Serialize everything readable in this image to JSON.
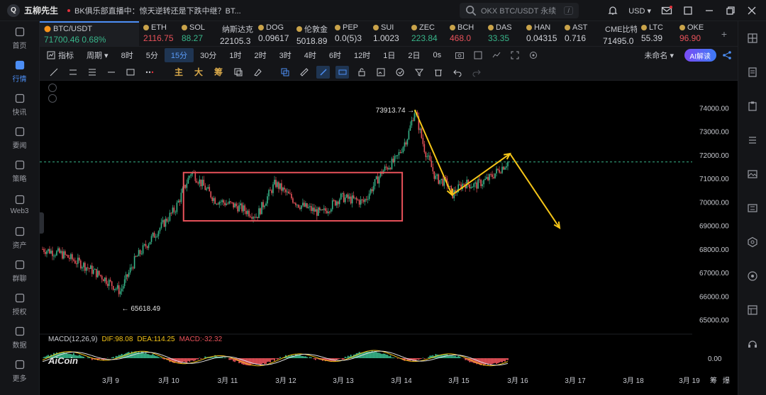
{
  "app": {
    "logo_mark": "Q",
    "name": "五柳先生"
  },
  "news": {
    "text": "BK俱乐部直播中：惊天逆转还是下跌中继？BT..."
  },
  "search": {
    "text": "OKX BTC/USDT 永续",
    "shortcut": "/"
  },
  "topright": {
    "currency": "USD"
  },
  "sidebar": [
    {
      "label": "首页",
      "icon": "home-icon"
    },
    {
      "label": "行情",
      "icon": "market-chart-icon",
      "active": true
    },
    {
      "label": "快讯",
      "icon": "flash-news-icon"
    },
    {
      "label": "要闻",
      "icon": "news-icon"
    },
    {
      "label": "策略",
      "icon": "strategy-icon"
    },
    {
      "label": "Web3",
      "icon": "web3-icon"
    },
    {
      "label": "资产",
      "icon": "wallet-icon"
    },
    {
      "label": "群聊",
      "icon": "group-chat-icon"
    },
    {
      "label": "授权",
      "icon": "authorize-icon"
    },
    {
      "label": "数据",
      "icon": "data-icon"
    },
    {
      "label": "更多",
      "icon": "more-icon"
    }
  ],
  "tickers": [
    {
      "name": "BTC/USDT",
      "price": "71700.46",
      "change": "0.68%",
      "dir": "up",
      "main": true
    },
    {
      "name": "ETH",
      "price": "2116.75",
      "dir": "down"
    },
    {
      "name": "SOL",
      "price": "88.27",
      "dir": "up"
    },
    {
      "name": "纳斯达克",
      "price": "22105.3",
      "dir": "neutral"
    },
    {
      "name": "DOG",
      "price": "0.09617",
      "dir": "neutral"
    },
    {
      "name": "伦敦金",
      "price": "5018.89",
      "dir": "neutral"
    },
    {
      "name": "PEP",
      "price": "0.0(5)3",
      "dir": "neutral"
    },
    {
      "name": "SUI",
      "price": "1.0023",
      "dir": "neutral"
    },
    {
      "name": "ZEC",
      "price": "223.84",
      "dir": "up"
    },
    {
      "name": "BCH",
      "price": "468.0",
      "dir": "down"
    },
    {
      "name": "DAS",
      "price": "33.35",
      "dir": "up"
    },
    {
      "name": "HAN",
      "price": "0.04315",
      "dir": "neutral"
    },
    {
      "name": "AST",
      "price": "0.716",
      "dir": "neutral"
    },
    {
      "name": "CME比特",
      "price": "71495.0",
      "dir": "neutral"
    },
    {
      "name": "LTC",
      "price": "55.39",
      "dir": "neutral"
    },
    {
      "name": "OKE",
      "price": "96.90",
      "dir": "down"
    }
  ],
  "timeframes": {
    "indicator": "指标",
    "period": "周期",
    "items": [
      "8时",
      "5分",
      "15分",
      "30分",
      "1时",
      "2时",
      "3时",
      "4时",
      "6时",
      "12时",
      "1日",
      "2日",
      "0s"
    ],
    "active": "15分",
    "untitled": "未命名",
    "ai": "AI解读"
  },
  "tools": {
    "main": "主",
    "big": "大",
    "chip": "筹"
  },
  "chart_data": {
    "type": "candlestick",
    "symbol": "BTC/USDT",
    "y_ticks": [
      74000,
      73000,
      72000,
      71000,
      70000,
      69000,
      68000,
      67000,
      66000,
      65000
    ],
    "y_tick_labels": [
      "74000.00",
      "73000.00",
      "72000.00",
      "71000.00",
      "70000.00",
      "69000.00",
      "68000.00",
      "67000.00",
      "66000.00",
      "65000.00"
    ],
    "ylim": [
      64450,
      75150
    ],
    "x_tick_labels": [
      "3月 9",
      "3月 10",
      "3月 11",
      "3月 12",
      "3月 13",
      "3月 14",
      "3月 15",
      "3月 16",
      "3月 17",
      "3月 18",
      "3月 19"
    ],
    "x_axis_extra": [
      "筹",
      "爆"
    ],
    "high_label": "73913.74",
    "low_label": "65618.49",
    "dashed_level": 71700,
    "path": [
      [
        0,
        68000
      ],
      [
        0.04,
        67800
      ],
      [
        0.09,
        67300
      ],
      [
        0.13,
        66800
      ],
      [
        0.167,
        66200
      ],
      [
        0.2,
        67600
      ],
      [
        0.24,
        68600
      ],
      [
        0.285,
        69700
      ],
      [
        0.32,
        71300
      ],
      [
        0.37,
        70100
      ],
      [
        0.42,
        69800
      ],
      [
        0.46,
        69400
      ],
      [
        0.5,
        70800
      ],
      [
        0.55,
        69900
      ],
      [
        0.6,
        69500
      ],
      [
        0.64,
        70200
      ],
      [
        0.69,
        70000
      ],
      [
        0.73,
        71300
      ],
      [
        0.76,
        71800
      ],
      [
        0.785,
        72800
      ],
      [
        0.8,
        73913
      ],
      [
        0.82,
        72300
      ],
      [
        0.845,
        71000
      ],
      [
        0.87,
        70800
      ],
      [
        0.88,
        70300
      ],
      [
        0.905,
        70800
      ],
      [
        0.93,
        70700
      ],
      [
        0.96,
        71000
      ],
      [
        1.0,
        71700
      ]
    ],
    "box": {
      "x_start": 0.303,
      "x_end": 0.773,
      "y_top": 71250,
      "y_bottom": 69200
    },
    "arrows": [
      {
        "points": [
          [
            73913,
            0
          ],
          [
            70300,
            1
          ]
        ]
      },
      {
        "points": [
          [
            70300,
            0
          ],
          [
            72050,
            1
          ]
        ]
      },
      {
        "points": [
          [
            72050,
            0
          ],
          [
            68900,
            1
          ]
        ]
      }
    ],
    "macd_legend": {
      "label": "MACD(12,26,9)",
      "dif": "DIF:98.08",
      "dea": "DEA:114.25",
      "macd": "MACD:-32.32"
    },
    "macd_zero_label": "0.00",
    "watermark": "AiCoin",
    "colors": {
      "up": "#38b58a",
      "down": "#e8525a",
      "box": "#e8525a",
      "arrow": "#f5c518",
      "dif": "#f5c518",
      "dea": "#e0e0e0"
    }
  }
}
